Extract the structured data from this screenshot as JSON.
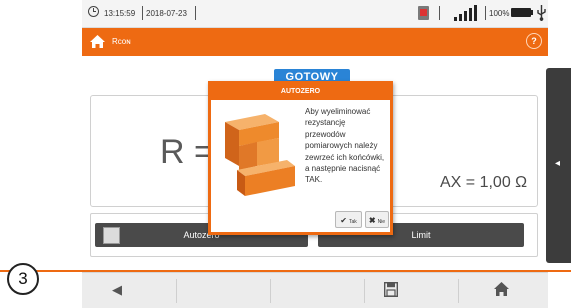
{
  "status_bar": {
    "time": "13:15:59",
    "date": "2018-07-23",
    "battery_percent": "100%"
  },
  "app_bar": {
    "title": "Rᴄᴏɴ",
    "help_label": "?"
  },
  "status_badge": "GOTOWY",
  "measurement": {
    "main_label": "R =",
    "max_label": "AX = 1,00 Ω"
  },
  "toolbar": {
    "autozero_label": "Autozero",
    "second_label": "Limit"
  },
  "step_label": "3",
  "dialog": {
    "title": "AUTOZERO",
    "message": "Aby wyeliminować rezystancję przewodów pomiarowych należy zewrzeć ich końcówki, a następnie nacisnąć TAK.",
    "yes_label": "Tak",
    "no_label": "Nie"
  },
  "colors": {
    "accent": "#ee6a12",
    "badge": "#2a84d6",
    "dark": "#3c3c3c"
  },
  "icons": [
    "clock-icon",
    "home-icon",
    "help-icon",
    "sd-card-icon",
    "signal-icon",
    "battery-icon",
    "usb-icon",
    "check-icon",
    "cross-icon",
    "back-arrow-icon",
    "save-icon",
    "chevron-left-icon"
  ]
}
